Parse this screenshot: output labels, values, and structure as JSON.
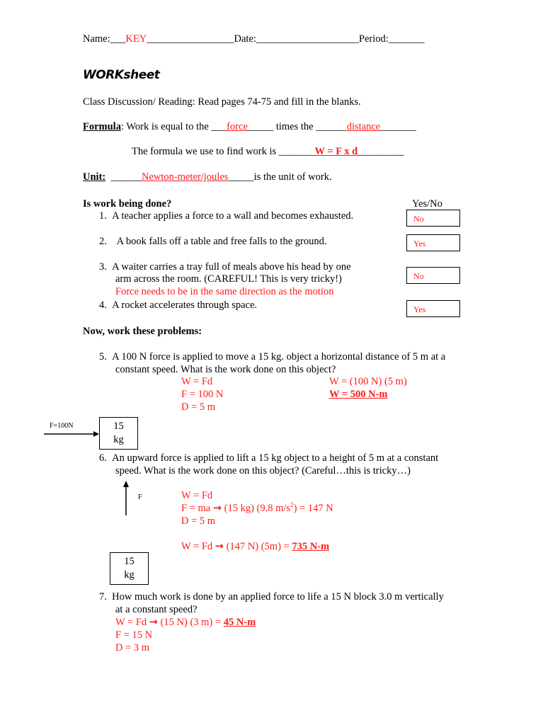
{
  "header": {
    "name_label": "Name:",
    "name_prefix_blank": "___",
    "name_value": "KEY",
    "name_suffix_blank": "_________________",
    "date_label": "Date:",
    "date_blank": "____________________",
    "period_label": "Period:",
    "period_blank": "_______"
  },
  "title": "WORKsheet",
  "intro": "Class Discussion/ Reading:  Read pages 74-75 and fill in the blanks.",
  "formula": {
    "label": "Formula",
    "colon": ":  Work is equal to the ",
    "blank1_pre": "___",
    "answer1": "force",
    "blank1_post": "_____",
    "mid": " times the ",
    "blank2_pre": "______",
    "answer2": "distance",
    "blank2_post": "_______",
    "line2_text": "The formula we use to find work is ",
    "blank3_pre": "_______",
    "answer3": "W = F x d",
    "blank3_post": "_________"
  },
  "unit": {
    "label": "Unit:",
    "blank_pre": "______",
    "answer": "Newton-meter/joules",
    "blank_post": "_____",
    "suffix": "is the unit of work."
  },
  "work_done": {
    "heading": "Is work being done?",
    "column_label": "Yes/No",
    "items": [
      {
        "num": "1.",
        "text": "A teacher applies a force to a wall and becomes exhausted.",
        "answer": "No"
      },
      {
        "num": "2.",
        "text": " A book falls off a table and free falls to the ground.",
        "answer": "Yes"
      },
      {
        "num": "3.",
        "text": "A waiter carries a tray full of meals above his head by one",
        "text2": "arm across the room.  (CAREFUL! This is very tricky!)",
        "note": "Force needs to be in the same direction as the motion",
        "answer": "No"
      },
      {
        "num": "4.",
        "text": "A rocket accelerates through space.",
        "answer": "Yes"
      }
    ]
  },
  "problems": {
    "heading": "Now, work these problems:",
    "p5": {
      "num": "5.",
      "line1": "A 100 N force is applied to move a 15 kg. object a horizontal distance of 5 m at a",
      "line2": "constant speed.  What is the work done on this object?",
      "work_left": [
        "W = Fd",
        "F = 100 N",
        "D = 5 m"
      ],
      "work_right1": "W = (100 N) (5 m)",
      "work_right2": "W = 500 N-m",
      "diagram_force_label": "F=100N",
      "box_line1": "15",
      "box_line2": "kg"
    },
    "p6": {
      "num": "6.",
      "line1": "An upward force is applied to lift a 15 kg object to a height of 5 m at a constant",
      "line2": "speed.  What is the work done on this object?  (Careful…this is tricky…)",
      "diagram_force_label": "F",
      "work1": "W = Fd",
      "work2_a": "F = ma  ",
      "work2_arrow": "→",
      "work2_b": " (15 kg) (9.8 m/s",
      "work2_sup": "2",
      "work2_c": ") = 147 N",
      "work3": "D = 5 m",
      "work4_a": "W = Fd ",
      "work4_arrow": "→",
      "work4_b": " (147 N) (5m) = ",
      "work4_answer": "735 N-m",
      "box_line1": "15",
      "box_line2": "kg"
    },
    "p7": {
      "num": "7.",
      "line1": "How much work is done by an applied force to life a 15 N block 3.0 m vertically",
      "line2": "at a constant speed?",
      "work1_a": "W = Fd ",
      "work1_arrow": "→",
      "work1_b": " (15 N) (3 m) = ",
      "work1_answer": "45 N-m",
      "work2": "F = 15 N",
      "work3": "D = 3 m"
    }
  },
  "colors": {
    "answer_red": "#ff1a1a",
    "text": "#000000"
  }
}
